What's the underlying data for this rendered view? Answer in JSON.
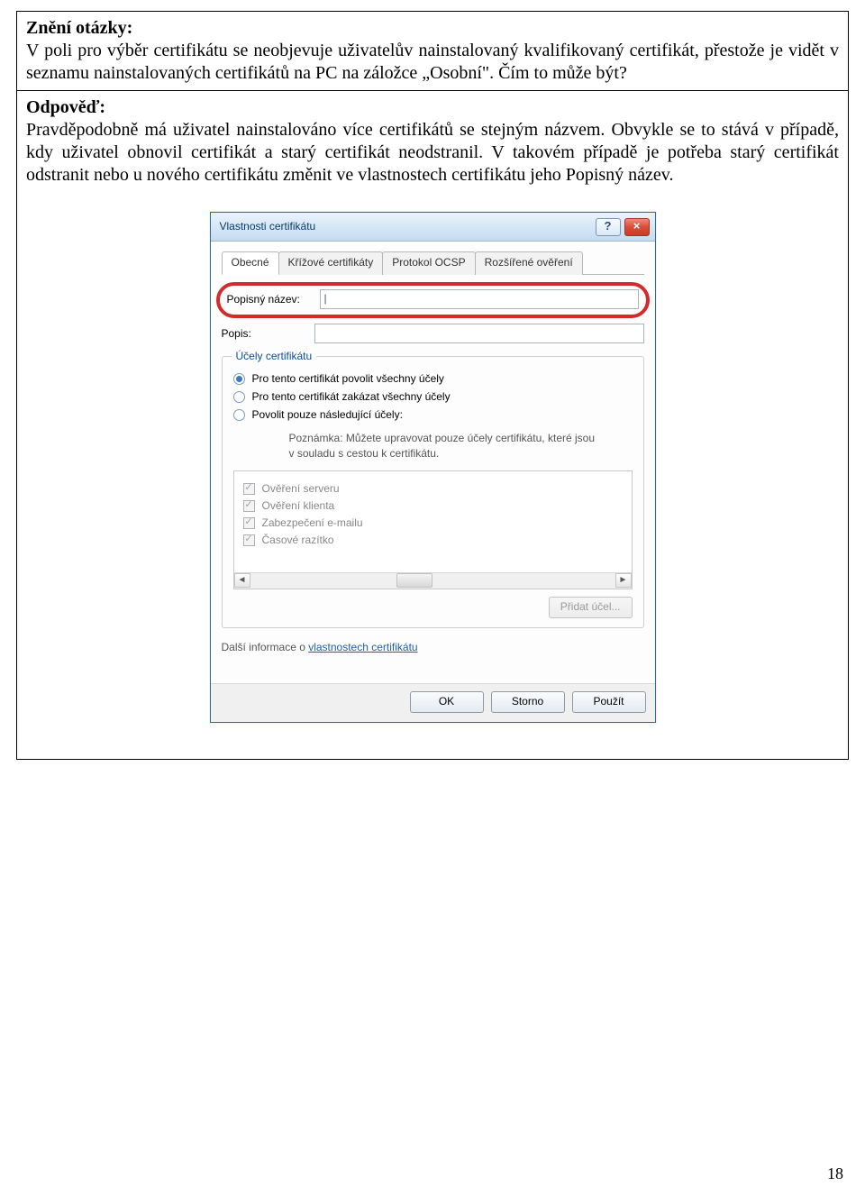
{
  "question": {
    "heading": "Znění otázky:",
    "body_pre": "V poli pro výběr certifikátu se neobjevuje uživatelův nainstalovaný kvalifikovaný certifikát, přestože je vidět v seznamu nainstalovaných certifikátů na PC na záložce „Osobní\". Čím to může být?"
  },
  "answer": {
    "heading": "Odpověď:",
    "body": "Pravděpodobně má uživatel nainstalováno více certifikátů se stejným názvem. Obvykle se to stává v případě, kdy uživatel obnovil certifikát a starý certifikát neodstranil. V takovém případě je potřeba starý certifikát odstranit nebo u nového certifikátu změnit ve vlastnostech certifikátu jeho Popisný název."
  },
  "dialog": {
    "title": "Vlastnosti certifikátu",
    "help": "?",
    "close": "×",
    "tabs": [
      "Obecné",
      "Křížové certifikáty",
      "Protokol OCSP",
      "Rozšířené ověření"
    ],
    "popisny_label": "Popisný název:",
    "popisny_value": "|",
    "popis_label": "Popis:",
    "group_legend": "Účely certifikátu",
    "radios": [
      "Pro tento certifikát povolit všechny účely",
      "Pro tento certifikát zakázat všechny účely",
      "Povolit pouze následující účely:"
    ],
    "note1": "Poznámka: Můžete upravovat pouze účely certifikátu, které jsou",
    "note2": "v souladu s cestou k certifikátu.",
    "checks": [
      "Ověření serveru",
      "Ověření klienta",
      "Zabezpečení e-mailu",
      "Časové razítko"
    ],
    "add_purpose": "Přidat účel...",
    "more_info_pre": "Další informace o ",
    "more_info_link": "vlastnostech certifikátu",
    "ok": "OK",
    "cancel": "Storno",
    "apply": "Použít"
  },
  "page_number": "18"
}
